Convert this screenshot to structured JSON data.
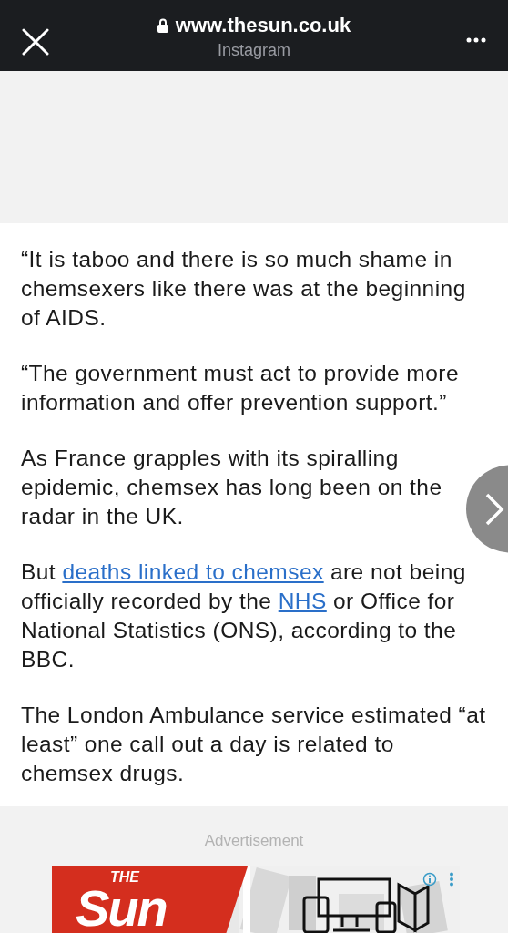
{
  "browser_bar": {
    "url": "www.thesun.co.uk",
    "subtitle": "Instagram",
    "secure": true
  },
  "article": {
    "paragraphs": [
      [
        {
          "kind": "text",
          "text": "“It is taboo and there is so much shame in chemsexers like there was at the beginning of AIDS."
        }
      ],
      [
        {
          "kind": "text",
          "text": "“The government must act to provide more information and offer prevention support.”"
        }
      ],
      [
        {
          "kind": "text",
          "text": "As France grapples with its spiralling epidemic, chemsex has long been on the radar in the UK."
        }
      ],
      [
        {
          "kind": "text",
          "text": "But "
        },
        {
          "kind": "link",
          "text": "deaths linked to chemsex"
        },
        {
          "kind": "text",
          "text": " are not being officially recorded by the "
        },
        {
          "kind": "link",
          "text": "NHS"
        },
        {
          "kind": "text",
          "text": " or Office for National Statistics (ONS), according to the BBC."
        }
      ],
      [
        {
          "kind": "text",
          "text": "The London Ambulance service estimated “at least” one call out a day is related to chemsex drugs."
        }
      ]
    ]
  },
  "advertisement": {
    "label": "Advertisement",
    "banner": {
      "logo_small": "THE",
      "logo": "Sun"
    }
  }
}
